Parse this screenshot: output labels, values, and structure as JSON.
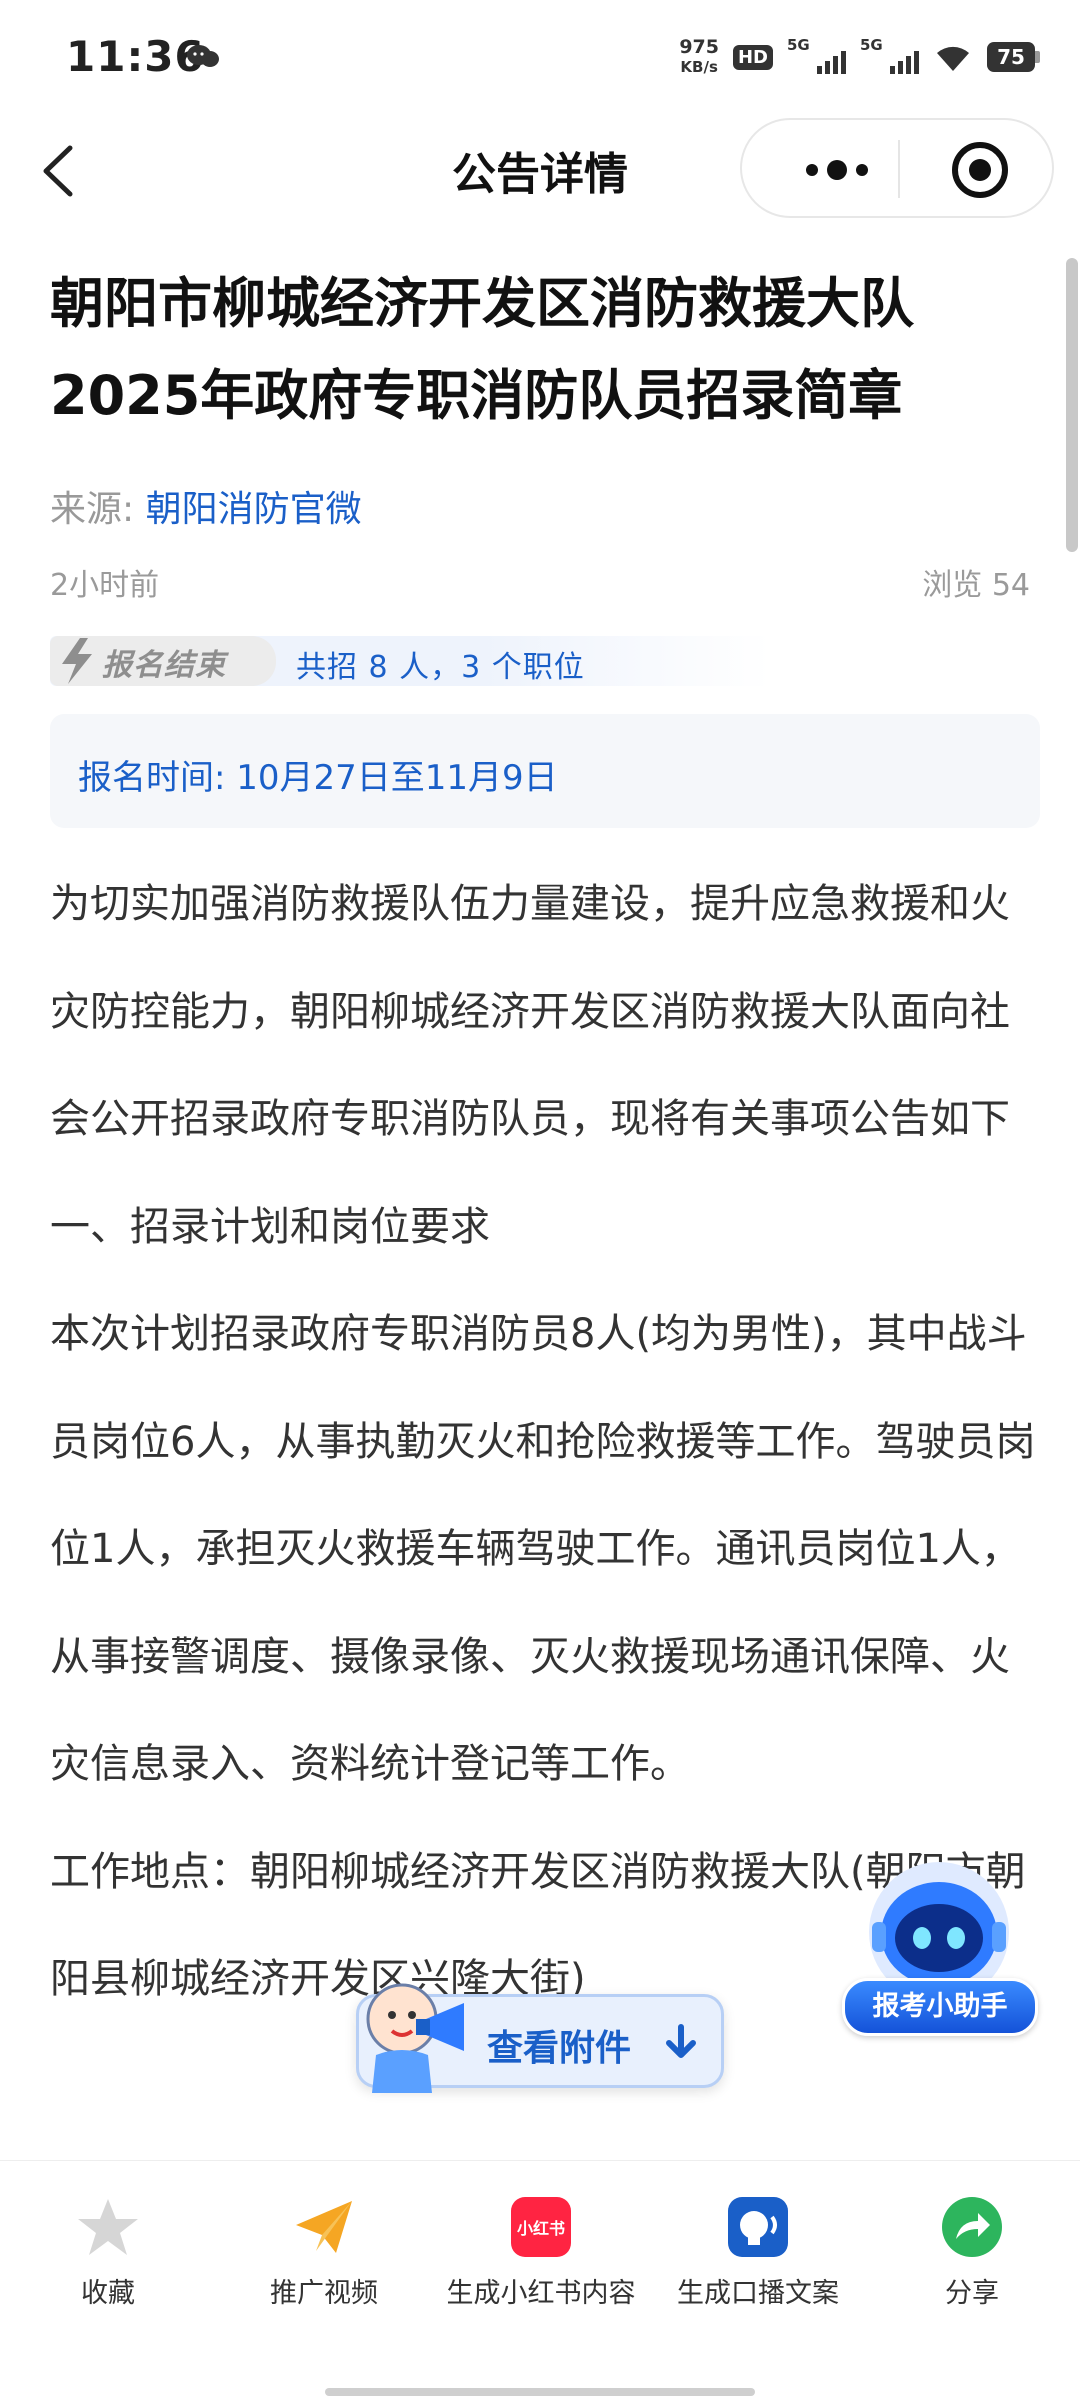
{
  "status_bar": {
    "time": "11:36",
    "net_speed_value": "975",
    "net_speed_unit": "KB/s",
    "hd_label": "HD",
    "sim_label": "5G",
    "battery": "75"
  },
  "nav": {
    "title": "公告详情"
  },
  "article": {
    "title": "朝阳市柳城经济开发区消防救援大队2025年政府专职消防队员招录简章",
    "source_label": "来源:",
    "source_name": "朝阳消防官微",
    "time_ago": "2小时前",
    "views": "浏览 54",
    "status_tag": "报名结束",
    "recruit_summary": "共招 8 人，3 个职位",
    "registration_time": "报名时间: 10月27日至11月9日",
    "paragraphs": [
      "为切实加强消防救援队伍力量建设，提升应急救援和火灾防控能力，朝阳柳城经济开发区消防救援大队面向社会公开招录政府专职消防队员，现将有关事项公告如下",
      "一、招录计划和岗位要求",
      "本次计划招录政府专职消防员8人(均为男性)，其中战斗员岗位6人，从事执勤灭火和抢险救援等工作。驾驶员岗位1人，承担灭火救援车辆驾驶工作。通讯员岗位1人，从事接警调度、摄像录像、灭火救援现场通讯保障、火灾信息录入、资料统计登记等工作。",
      "工作地点：朝阳柳城经济开发区消防救援大队(朝阳市朝阳县柳城经济开发区兴隆大街)"
    ]
  },
  "floating": {
    "assistant_label": "报考小助手",
    "attachment_label": "查看附件"
  },
  "bottom_bar": {
    "items": [
      {
        "label": "收藏",
        "icon": "star-icon"
      },
      {
        "label": "推广视频",
        "icon": "paper-plane-icon"
      },
      {
        "label": "生成小红书内容",
        "icon": "xiaohongshu-icon",
        "icon_text": "小红书"
      },
      {
        "label": "生成口播文案",
        "icon": "speech-icon"
      },
      {
        "label": "分享",
        "icon": "share-icon"
      }
    ]
  },
  "colors": {
    "accent": "#1a5fc8",
    "share_green": "#2db55d",
    "xhs_red": "#ff2442",
    "plane_yellow": "#f5a623"
  }
}
